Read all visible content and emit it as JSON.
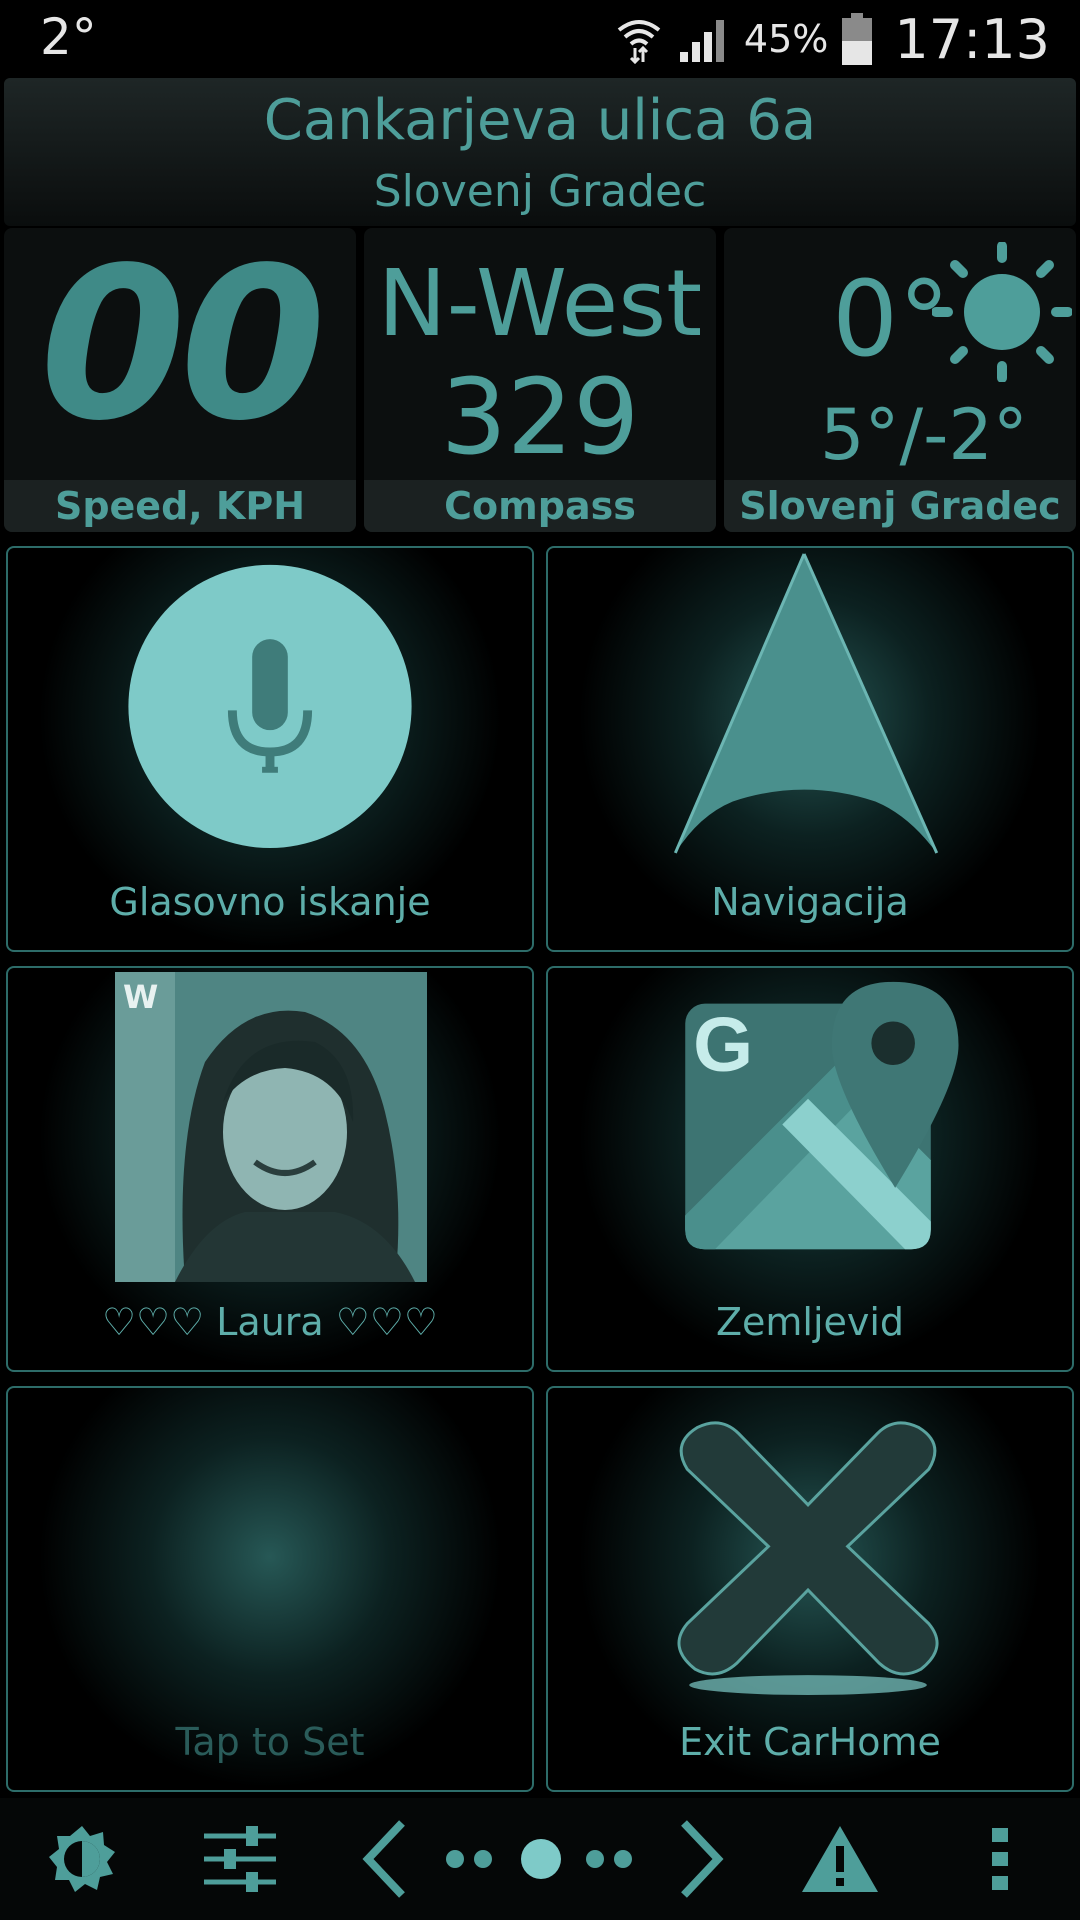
{
  "status_bar": {
    "temperature": "2°",
    "battery_percent": "45%",
    "time": "17:13",
    "icons": [
      "wifi-icon",
      "signal-icon",
      "battery-icon"
    ]
  },
  "header": {
    "street": "Cankarjeva ulica 6a",
    "city": "Slovenj Gradec"
  },
  "widgets": {
    "speed": {
      "value": "00",
      "label": "Speed, KPH"
    },
    "compass": {
      "direction": "N-West",
      "degrees": "329",
      "label": "Compass"
    },
    "weather": {
      "temperature": "0°",
      "range": "5°/-2°",
      "label": "Slovenj Gradec",
      "icon": "sun-icon"
    }
  },
  "tiles": [
    {
      "label": "Glasovno iskanje",
      "icon": "microphone-icon"
    },
    {
      "label": "Navigacija",
      "icon": "navigation-arrow-icon"
    },
    {
      "label": "♡♡♡ Laura ♡♡♡",
      "icon": "contact-photo"
    },
    {
      "label": "Zemljevid",
      "icon": "google-maps-icon",
      "icon_letter": "G"
    },
    {
      "label": "Tap to Set",
      "icon": "empty-slot"
    },
    {
      "label": "Exit CarHome",
      "icon": "close-x-icon"
    }
  ],
  "bottom_bar": {
    "buttons": [
      "brightness-icon",
      "equalizer-icon",
      "prev-page-icon",
      "page-indicator",
      "next-page-icon",
      "warning-icon",
      "more-menu-icon"
    ],
    "pages": 5,
    "current_page": 3
  },
  "colors": {
    "accent": "#4e9e9a",
    "accent_light": "#7ecac8",
    "border": "#2d6c69",
    "background": "#000000"
  }
}
